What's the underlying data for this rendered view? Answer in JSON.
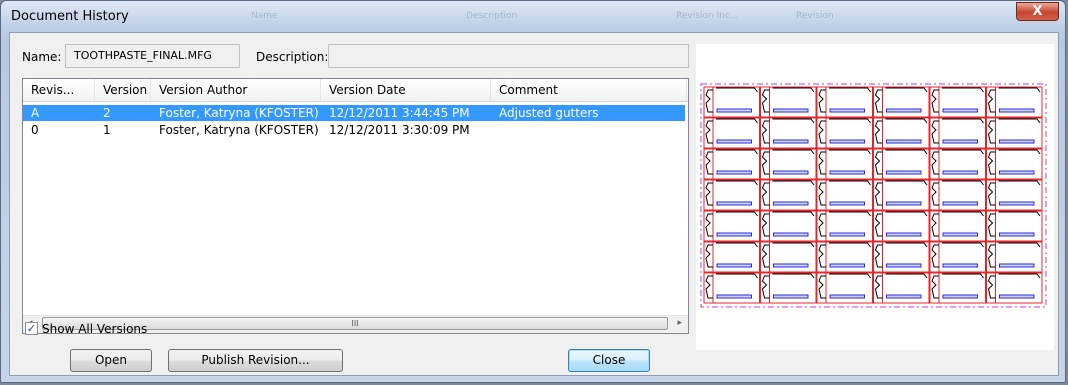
{
  "window": {
    "title": "Document History",
    "close_glyph": "X"
  },
  "background_ghost": [
    "Name",
    "Description",
    "Revision Inc...",
    "Revision"
  ],
  "form": {
    "name_label": "Name:",
    "name_value": "TOOTHPASTE_FINAL.MFG",
    "description_label": "Description:",
    "description_value": ""
  },
  "table": {
    "columns": [
      "Revis...",
      "Version",
      "Version Author",
      "Version Date",
      "Comment"
    ],
    "rows": [
      {
        "revision": "A",
        "version": "2",
        "author": "Foster, Katryna (KFOSTER)",
        "date": "12/12/2011 3:44:45 PM",
        "comment": "Adjusted gutters",
        "selected": true
      },
      {
        "revision": "0",
        "version": "1",
        "author": "Foster, Katryna (KFOSTER)",
        "date": "12/12/2011 3:30:09 PM",
        "comment": "",
        "selected": false
      }
    ]
  },
  "scrollbar": {
    "left_arrow": "◂",
    "right_arrow": "▸",
    "grip": "III"
  },
  "show_all_versions": {
    "label": "Show All Versions",
    "checked": true,
    "check_glyph": "✓"
  },
  "buttons": {
    "open": "Open",
    "publish": "Publish Revision...",
    "close": "Close"
  },
  "preview": {
    "grid_rows": 7,
    "grid_cols": 6,
    "outline_color": "#e8242b",
    "detail_color": "#2a2ad6",
    "border_color": "#c83cc8"
  }
}
